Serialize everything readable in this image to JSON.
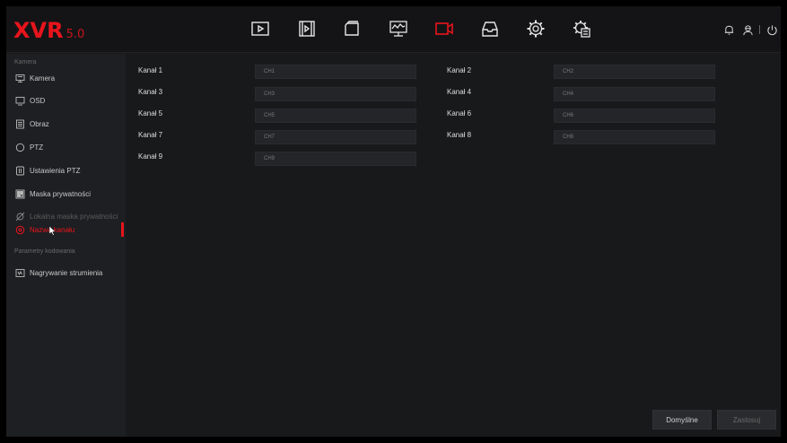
{
  "header": {
    "brand": "XVR",
    "version": "5.0",
    "nav_icons": [
      "playback-icon",
      "video-clip-icon",
      "files-icon",
      "monitor-icon",
      "camera-icon",
      "storage-icon",
      "settings-icon",
      "system-settings-icon"
    ],
    "active_icon": "camera-icon",
    "right_icons": [
      "alarm-bell-icon",
      "user-icon",
      "power-icon"
    ]
  },
  "colors": {
    "accent": "#e8141c",
    "background": "#18191b",
    "sidebar": "#1e1f22",
    "input": "#242528"
  },
  "sidebar": {
    "group1_title": "Kamera",
    "items": [
      {
        "label": "Kamera",
        "icon": "camera-list-icon",
        "state": "normal"
      },
      {
        "label": "OSD",
        "icon": "monitor-icon",
        "state": "normal"
      },
      {
        "label": "Obraz",
        "icon": "image-icon",
        "state": "normal"
      },
      {
        "label": "PTZ",
        "icon": "ptz-icon",
        "state": "normal"
      },
      {
        "label": "Ustawienia PTZ",
        "icon": "ptz-settings-icon",
        "state": "normal"
      },
      {
        "label": "Maska prywatności",
        "icon": "privacy-mask-icon",
        "state": "normal"
      },
      {
        "label": "Lokalna maska prywatności",
        "icon": "local-mask-icon",
        "state": "disabled"
      },
      {
        "label": "Nazwa kanału",
        "icon": "channel-name-icon",
        "state": "active"
      }
    ],
    "group2_title": "Parametry kodowania",
    "items2": [
      {
        "label": "Nagrywanie strumienia",
        "icon": "stream-icon",
        "state": "normal"
      }
    ]
  },
  "channels": [
    {
      "label": "Kanał 1",
      "value": "CH1"
    },
    {
      "label": "Kanał 2",
      "value": "CH2"
    },
    {
      "label": "Kanał 3",
      "value": "CH3"
    },
    {
      "label": "Kanał 4",
      "value": "CH4"
    },
    {
      "label": "Kanał 5",
      "value": "CH5"
    },
    {
      "label": "Kanał 6",
      "value": "CH6"
    },
    {
      "label": "Kanał 7",
      "value": "CH7"
    },
    {
      "label": "Kanał 8",
      "value": "CH8"
    },
    {
      "label": "Kanał 9",
      "value": "CH9"
    }
  ],
  "buttons": {
    "default_label": "Domyślne",
    "apply_label": "Zastosuj"
  }
}
